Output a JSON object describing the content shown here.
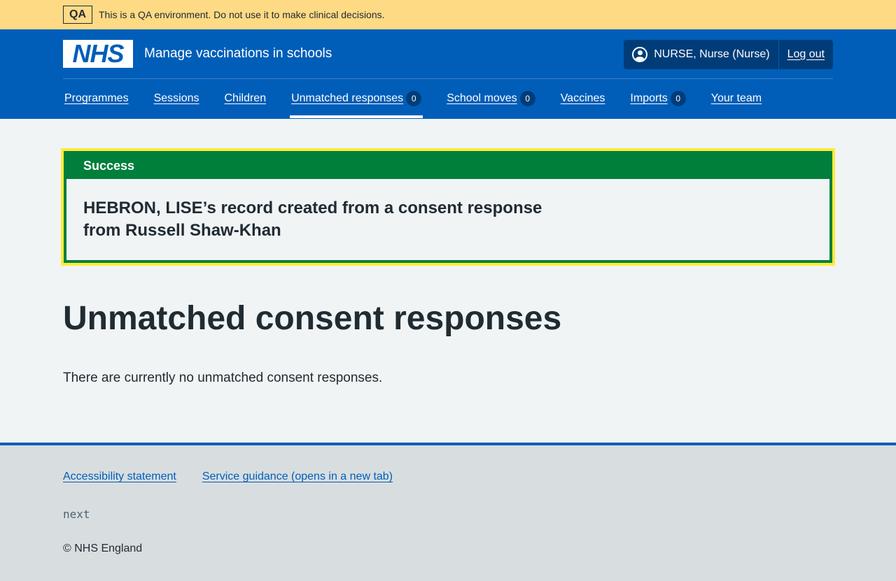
{
  "env_banner": {
    "tag": "QA",
    "text": "This is a QA environment. Do not use it to make clinical decisions."
  },
  "header": {
    "logo_text": "NHS",
    "service_name": "Manage vaccinations in schools",
    "account": {
      "user": "NURSE, Nurse (Nurse)",
      "logout": "Log out"
    }
  },
  "nav": {
    "items": [
      {
        "label": "Programmes"
      },
      {
        "label": "Sessions"
      },
      {
        "label": "Children"
      },
      {
        "label": "Unmatched responses",
        "badge": "0",
        "active": true
      },
      {
        "label": "School moves",
        "badge": "0"
      },
      {
        "label": "Vaccines"
      },
      {
        "label": "Imports",
        "badge": "0"
      },
      {
        "label": "Your team"
      }
    ]
  },
  "success_banner": {
    "title": "Success",
    "message": "HEBRON, LISE’s record created from a consent response from Russell Shaw-Khan"
  },
  "main": {
    "title": "Unmatched consent responses",
    "body": "There are currently no unmatched consent responses."
  },
  "footer": {
    "links": [
      "Accessibility statement",
      "Service guidance (opens in a new tab)"
    ],
    "version": "next",
    "copyright": "© NHS England"
  }
}
